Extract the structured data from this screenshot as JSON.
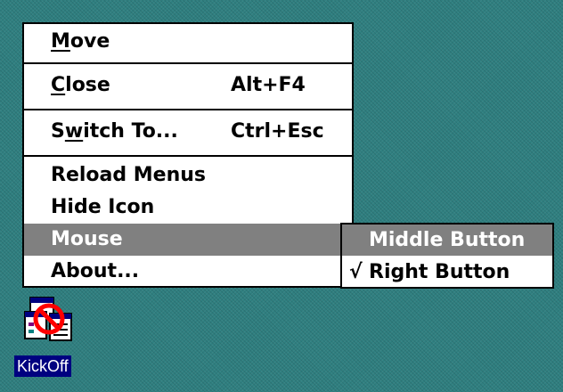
{
  "menu": {
    "items": [
      {
        "label_pre": "",
        "label_ul": "M",
        "label_post": "ove",
        "accel": ""
      },
      {
        "label_pre": "",
        "label_ul": "C",
        "label_post": "lose",
        "accel": "Alt+F4"
      },
      {
        "label_pre": "S",
        "label_ul": "w",
        "label_post": "itch To...",
        "accel": "Ctrl+Esc"
      },
      {
        "label": "Reload Menus"
      },
      {
        "label": "Hide Icon"
      },
      {
        "label": "Mouse"
      },
      {
        "label": "About..."
      }
    ]
  },
  "submenu": {
    "items": [
      {
        "label": "Middle Button",
        "checked": false
      },
      {
        "label": "Right Button",
        "checked": true,
        "check_glyph": "√"
      }
    ]
  },
  "desktop_icon": {
    "label": "KickOff",
    "icon": "kickoff-no-symbol-icon"
  },
  "colors": {
    "desktop": "#2f7f80",
    "highlight": "#808080",
    "icon_label_bg": "#000080"
  }
}
